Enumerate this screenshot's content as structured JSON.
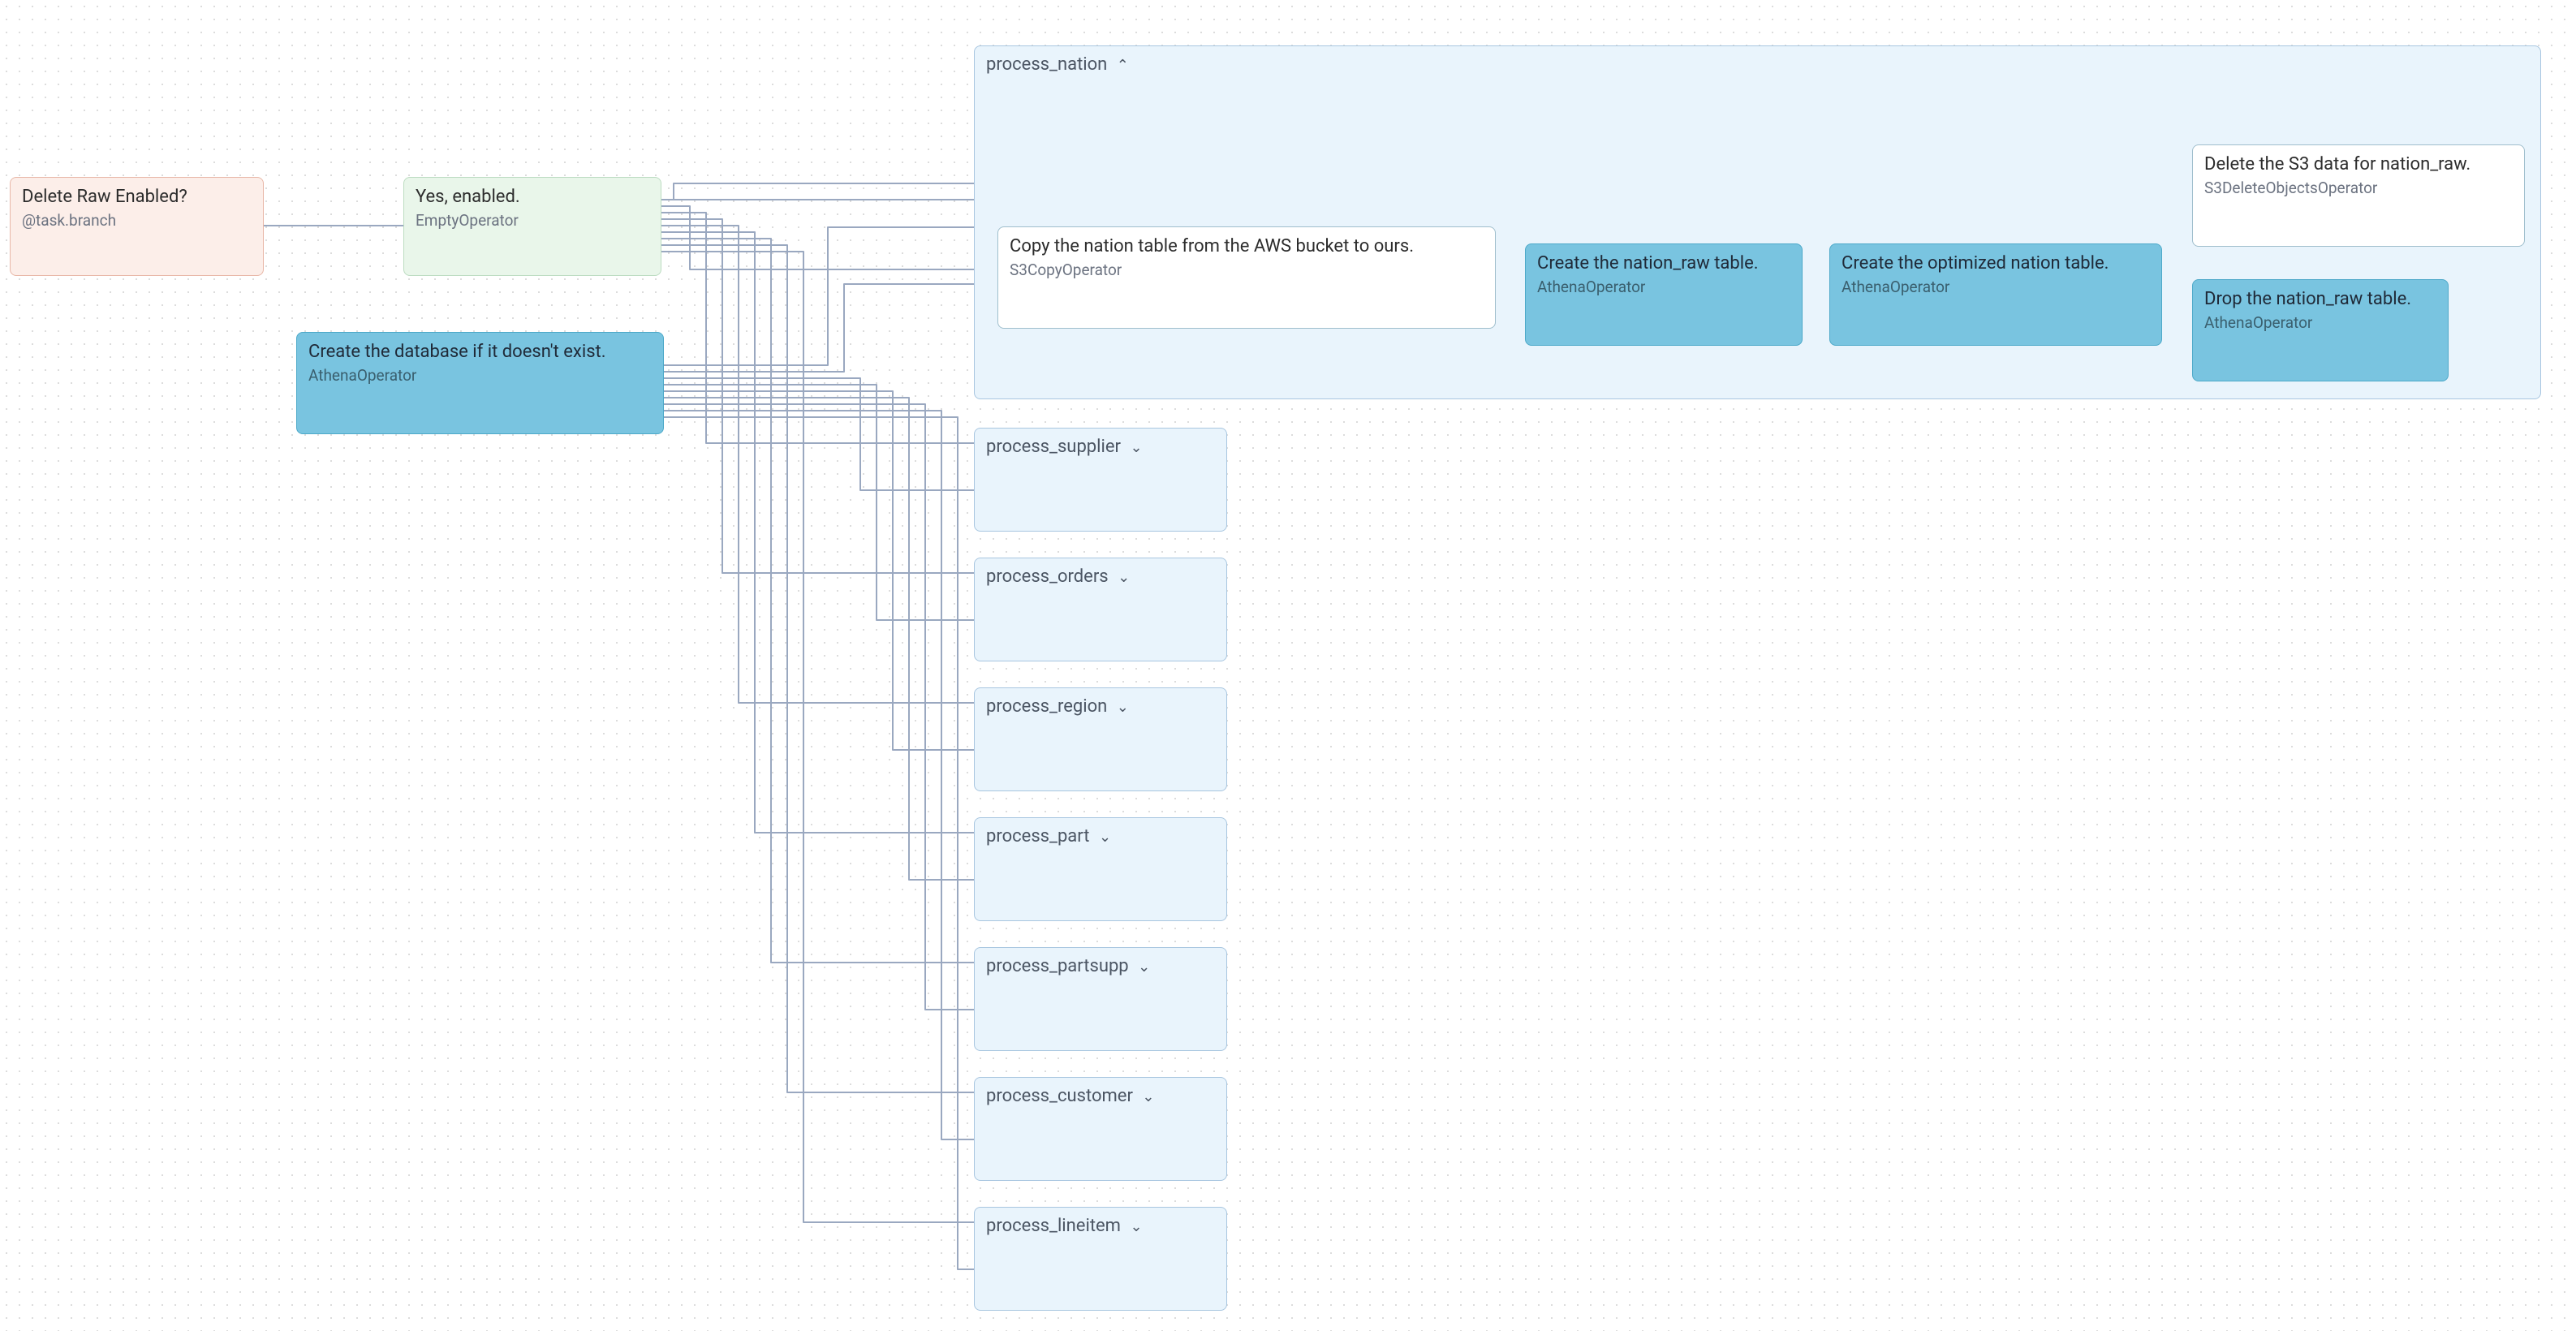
{
  "task_delete_enabled": {
    "title": "Delete Raw Enabled?",
    "sub": "@task.branch"
  },
  "task_yes_enabled": {
    "title": "Yes, enabled.",
    "sub": "EmptyOperator"
  },
  "task_create_db": {
    "title": "Create the database if it doesn't exist.",
    "sub": "AthenaOperator"
  },
  "group_expanded": {
    "name": "process_nation",
    "copy": {
      "title": "Copy the nation table from the AWS bucket to ours.",
      "sub": "S3CopyOperator"
    },
    "create_raw": {
      "title": "Create the nation_raw table.",
      "sub": "AthenaOperator"
    },
    "create_opt": {
      "title": "Create the optimized nation table.",
      "sub": "AthenaOperator"
    },
    "delete_s3": {
      "title": "Delete the S3 data for nation_raw.",
      "sub": "S3DeleteObjectsOperator"
    },
    "drop_raw": {
      "title": "Drop the nation_raw table.",
      "sub": "AthenaOperator"
    }
  },
  "collapsed_groups": [
    {
      "name": "process_supplier"
    },
    {
      "name": "process_orders"
    },
    {
      "name": "process_region"
    },
    {
      "name": "process_part"
    },
    {
      "name": "process_partsupp"
    },
    {
      "name": "process_customer"
    },
    {
      "name": "process_lineitem"
    }
  ]
}
